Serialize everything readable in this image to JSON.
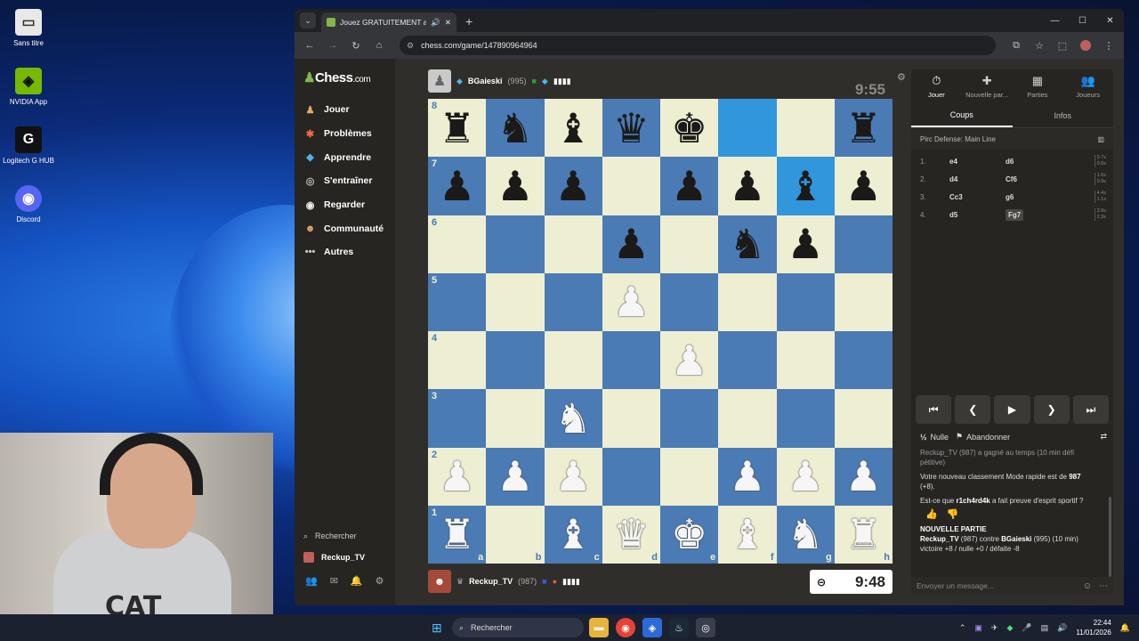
{
  "desktop": {
    "icons": [
      {
        "label": "Sans titre",
        "glyph": "▭",
        "bg": "#e8e8e8"
      },
      {
        "label": "NVIDIA App",
        "glyph": "◈",
        "bg": "#76b900"
      },
      {
        "label": "Logitech G HUB",
        "glyph": "G",
        "bg": "#111"
      },
      {
        "label": "Discord",
        "glyph": "◉",
        "bg": "#5865f2"
      }
    ],
    "webcam_logo": "CAT"
  },
  "browser": {
    "tab_title": "Jouez GRATUITEMENT aux",
    "url": "chess.com/game/147890964964"
  },
  "sidebar": {
    "logo": "Chess",
    "logo_suffix": ".com",
    "items": [
      {
        "label": "Jouer",
        "icon": "♟",
        "color": "#e6a96b"
      },
      {
        "label": "Problèmes",
        "icon": "✱",
        "color": "#f36b4a"
      },
      {
        "label": "Apprendre",
        "icon": "🎓",
        "color": "#4fb3e8"
      },
      {
        "label": "S'entraîner",
        "icon": "◎",
        "color": "#bbb"
      },
      {
        "label": "Regarder",
        "icon": "◉",
        "color": "#eee"
      },
      {
        "label": "Communauté",
        "icon": "☻",
        "color": "#e6a96b"
      },
      {
        "label": "Autres",
        "icon": "•••",
        "color": "#ccc"
      }
    ],
    "search_label": "Rechercher",
    "user_label": "Reckup_TV"
  },
  "opponent": {
    "name": "BGaieski",
    "rating": "(995)",
    "clock": "9:55"
  },
  "me": {
    "name": "Reckup_TV",
    "rating": "(987)",
    "clock": "9:48"
  },
  "board": {
    "ranks": [
      "8",
      "7",
      "6",
      "5",
      "4",
      "3",
      "2",
      "1"
    ],
    "files": [
      "a",
      "b",
      "c",
      "d",
      "e",
      "f",
      "g",
      "h"
    ],
    "position": [
      [
        "r",
        "n",
        "b",
        "q",
        "k",
        "",
        "",
        "r"
      ],
      [
        "p",
        "p",
        "p",
        "",
        "p",
        "p",
        "b",
        "p"
      ],
      [
        "",
        "",
        "",
        "p",
        "",
        "n",
        "p",
        ""
      ],
      [
        "",
        "",
        "",
        "P",
        "",
        "",
        "",
        ""
      ],
      [
        "",
        "",
        "",
        "",
        "P",
        "",
        "",
        ""
      ],
      [
        "",
        "",
        "N",
        "",
        "",
        "",
        "",
        ""
      ],
      [
        "P",
        "P",
        "P",
        "",
        "",
        "P",
        "P",
        "P"
      ],
      [
        "R",
        "",
        "B",
        "Q",
        "K",
        "B",
        "N",
        "R"
      ]
    ],
    "highlights": [
      "f8",
      "g7"
    ]
  },
  "rpanel": {
    "tabs": [
      {
        "label": "Jouer",
        "icon": "⏱",
        "active": true
      },
      {
        "label": "Nouvelle par...",
        "icon": "✚",
        "active": false
      },
      {
        "label": "Parties",
        "icon": "▦",
        "active": false
      },
      {
        "label": "Joueurs",
        "icon": "👥",
        "active": false
      }
    ],
    "subtabs": [
      "Coups",
      "Infos"
    ],
    "opening": "Pirc Defense: Main Line",
    "moves": [
      {
        "num": "1.",
        "white": "e4",
        "black": "d6",
        "t1": "0.7s",
        "t2": "0.6s"
      },
      {
        "num": "2.",
        "white": "d4",
        "black": "Cf6",
        "t1": "1.6s",
        "t2": "0.9s"
      },
      {
        "num": "3.",
        "white": "Cc3",
        "black": "g6",
        "t1": "4.4s",
        "t2": "1.1s"
      },
      {
        "num": "4.",
        "white": "d5",
        "black": "Fg7",
        "t1": "3.9s",
        "t2": "2.3s"
      }
    ],
    "draw_label": "Nulle",
    "draw_prefix": "½",
    "resign_label": "Abandonner",
    "chat": {
      "line1": "Reckup_TV (987) a gagné au temps (10 min défi",
      "line1b": "pétitive)",
      "line2_pre": "Votre nouveau classement Mode rapide est de ",
      "line2_val": "987",
      "line2_post": "(+8).",
      "line3_pre": "Est-ce que ",
      "line3_name": "r1ch4rd4k",
      "line3_post": " a fait preuve d'esprit sportif ?",
      "new_game": "NOUVELLE PARTIE",
      "match_a": "Reckup_TV",
      "match_mid": " (987) contre ",
      "match_b": "BGaieski",
      "match_tail": " (995) (10 min)",
      "result": "victoire +8 / nulle +0 / défaite -8"
    },
    "chat_placeholder": "Envoyer un message..."
  },
  "taskbar": {
    "search": "Rechercher",
    "time": "22:44",
    "date": "11/01/2026"
  }
}
